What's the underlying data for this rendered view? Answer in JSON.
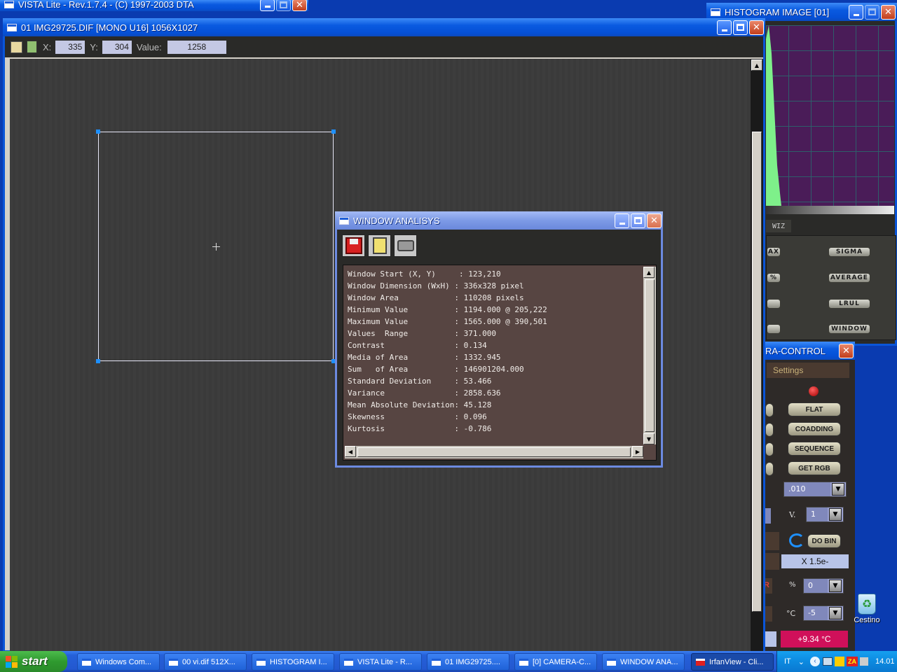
{
  "vista_window": {
    "title": "VISTA Lite - Rev.1.7.4 - (C) 1997-2003 DTA"
  },
  "image_window": {
    "title": "01 IMG29725.DIF [MONO U16] 1056X1027",
    "toolbar": {
      "x_label": "X:",
      "x_value": "335",
      "y_label": "Y:",
      "y_value": "304",
      "value_label": "Value:",
      "value": "1258"
    }
  },
  "histogram_window": {
    "title": "HISTOGRAM IMAGE [01]",
    "tab_label": "WIZ",
    "buttons": [
      {
        "left": "AX",
        "right": "SIGMA"
      },
      {
        "left": "%",
        "right": "AVERAGE"
      },
      {
        "left": "",
        "right": "LRUL"
      },
      {
        "left": "",
        "right": "WINDOW"
      }
    ]
  },
  "analysis_window": {
    "title": "WINDOW ANALISYS",
    "rows": [
      {
        "label": "Window Start (X, Y)     ",
        "value": "123,210"
      },
      {
        "label": "Window Dimension (WxH) ",
        "value": "336x328 pixel"
      },
      {
        "label": "Window Area            ",
        "value": "110208 pixels"
      },
      {
        "label": "Minimum Value          ",
        "value": "1194.000 @ 205,222"
      },
      {
        "label": "Maximum Value          ",
        "value": "1565.000 @ 390,501"
      },
      {
        "label": "Values  Range          ",
        "value": "371.000"
      },
      {
        "label": "Contrast               ",
        "value": "0.134"
      },
      {
        "label": "Media of Area          ",
        "value": "1332.945"
      },
      {
        "label": "Sum   of Area          ",
        "value": "146901204.000"
      },
      {
        "label": "Standard Deviation     ",
        "value": "53.466"
      },
      {
        "label": "Variance               ",
        "value": "2858.636"
      },
      {
        "label": "Mean Absolute Deviation",
        "value": "45.128"
      },
      {
        "label": "Skewness               ",
        "value": "0.096"
      },
      {
        "label": "Kurtosis               ",
        "value": "-0.786"
      }
    ]
  },
  "camera_window": {
    "title": "RA-CONTROL",
    "settings_label": "Settings",
    "buttons": [
      "FLAT",
      "COADDING",
      "SEQUENCE",
      "GET RGB"
    ],
    "exposure_value": ".010",
    "v_label": "V.",
    "v_value": "1",
    "do_bin_label": "DO BIN",
    "gain_label": "X 1.5e-",
    "percent_label": "%",
    "percent_value": "0",
    "temp_unit": "°C",
    "temp_setpoint": "-5",
    "temp_reading": "+9.34 °C",
    "left_glyphs": [
      "R"
    ]
  },
  "desktop": {
    "recycle_bin_label": "Cestino"
  },
  "taskbar": {
    "start_label": "start",
    "tasks": [
      "Windows Com...",
      "00 vi.dif 512X...",
      "HISTOGRAM I...",
      "VISTA Lite - R...",
      "01 IMG29725....",
      "[0] CAMERA-C...",
      "WINDOW ANA...",
      "IrfanView - Cli..."
    ],
    "language": "IT",
    "clock": "14.01"
  },
  "colors": {
    "histogram_bg": "#4a1c58",
    "histogram_curve": "#7ef08a",
    "analysis_bg": "#574542",
    "image_bg": "#3a3a3a",
    "temp_bg": "#d0105a"
  }
}
